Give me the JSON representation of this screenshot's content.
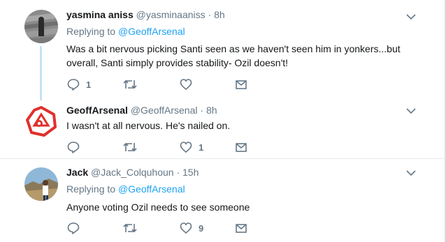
{
  "tweets": [
    {
      "name": "yasmina aniss",
      "handle": "@yasminaaniss",
      "dot": "·",
      "time": "8h",
      "replying_label": "Replying to",
      "replying_handle": "@GeoffArsenal",
      "text": "Was a bit nervous picking Santi seen as we haven't seen him in yonkers...but overall, Santi simply provides stability- Ozil doesn't!",
      "reply_count": "1",
      "retweet_count": "",
      "like_count": ""
    },
    {
      "name": "GeoffArsenal",
      "handle": "@GeoffArsenal",
      "dot": "·",
      "time": "8h",
      "text": "I wasn't at all nervous. He's nailed on.",
      "reply_count": "",
      "retweet_count": "",
      "like_count": "1"
    },
    {
      "name": "Jack",
      "handle": "@Jack_Colquhoun",
      "dot": "·",
      "time": "15h",
      "replying_label": "Replying to",
      "replying_handle": "@GeoffArsenal",
      "text": "Anyone voting Ozil needs to see someone",
      "reply_count": "",
      "retweet_count": "",
      "like_count": "9"
    }
  ],
  "colors": {
    "accent": "#1da1f2",
    "muted": "#657786",
    "thread": "#c4e2f7",
    "arsenal_red": "#e0302d"
  },
  "icons": [
    "reply-icon",
    "retweet-icon",
    "like-icon",
    "dm-icon",
    "chevron-down-icon"
  ]
}
